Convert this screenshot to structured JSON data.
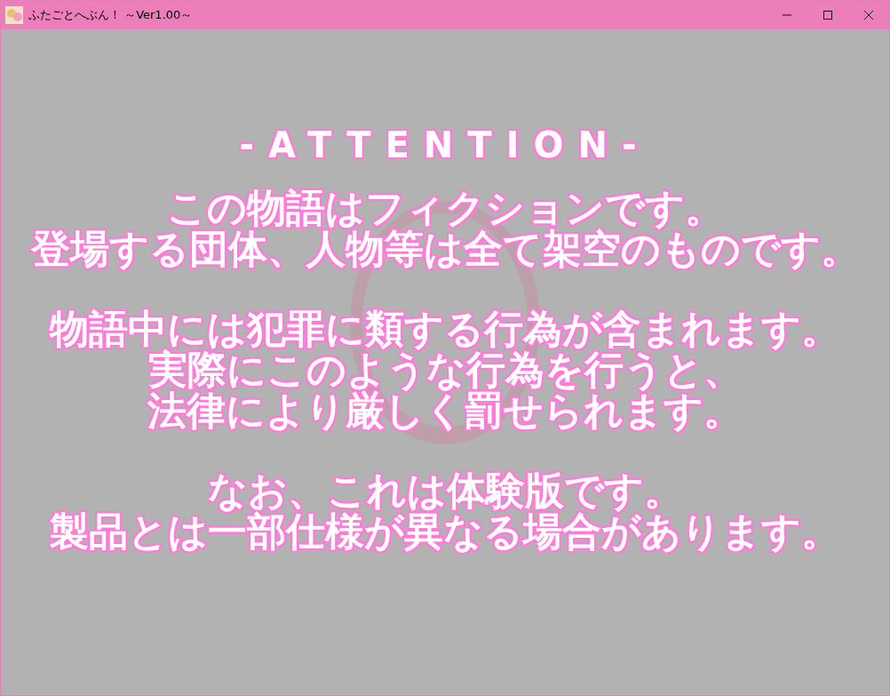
{
  "window": {
    "title": "ふたごとへぶん！ ～Ver1.00～"
  },
  "notice": {
    "heading": "-ATTENTION-",
    "paragraphs": [
      [
        "この物語はフィクションです。",
        "登場する団体、人物等は全て架空のものです。"
      ],
      [
        "物語中には犯罪に類する行為が含まれます。",
        "実際にこのような行為を行うと、",
        "法律により厳しく罰せられます。"
      ],
      [
        "なお、これは体験版です。",
        "製品とは一部仕様が異なる場合があります。"
      ]
    ]
  }
}
